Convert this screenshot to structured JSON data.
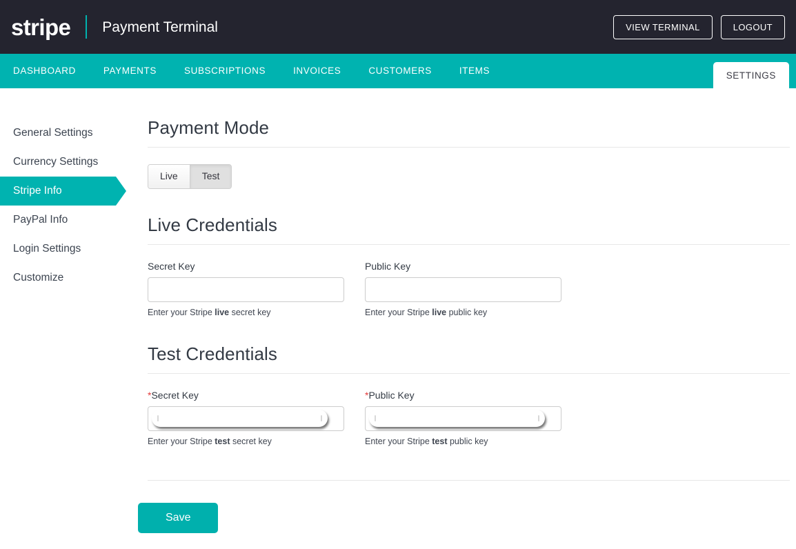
{
  "header": {
    "logo_text": "stripe",
    "title": "Payment Terminal",
    "view_terminal_label": "VIEW TERMINAL",
    "logout_label": "LOGOUT",
    "background_color": "#24242f",
    "accent_color": "#00b3b0"
  },
  "nav": {
    "items": [
      {
        "label": "DASHBOARD",
        "active": false
      },
      {
        "label": "PAYMENTS",
        "active": false
      },
      {
        "label": "SUBSCRIPTIONS",
        "active": false
      },
      {
        "label": "INVOICES",
        "active": false
      },
      {
        "label": "CUSTOMERS",
        "active": false
      },
      {
        "label": "ITEMS",
        "active": false
      }
    ],
    "settings_tab_label": "SETTINGS",
    "background_color": "#00b3b0"
  },
  "sidebar": {
    "items": [
      {
        "label": "General Settings",
        "active": false
      },
      {
        "label": "Currency Settings",
        "active": false
      },
      {
        "label": "Stripe Info",
        "active": true
      },
      {
        "label": "PayPal Info",
        "active": false
      },
      {
        "label": "Login Settings",
        "active": false
      },
      {
        "label": "Customize",
        "active": false
      }
    ],
    "active_color": "#00b3b0"
  },
  "main": {
    "payment_mode": {
      "title": "Payment Mode",
      "options": [
        {
          "label": "Live",
          "selected": false
        },
        {
          "label": "Test",
          "selected": true
        }
      ]
    },
    "live_credentials": {
      "title": "Live Credentials",
      "secret_key": {
        "label": "Secret Key",
        "required": false,
        "value": "",
        "placeholder": "",
        "help_prefix": "Enter your Stripe ",
        "help_bold": "live",
        "help_suffix": " secret key"
      },
      "public_key": {
        "label": "Public Key",
        "required": false,
        "value": "",
        "placeholder": "",
        "help_prefix": "Enter your Stripe ",
        "help_bold": "live",
        "help_suffix": " public key"
      }
    },
    "test_credentials": {
      "title": "Test Credentials",
      "secret_key": {
        "label": "Secret Key",
        "required": true,
        "required_marker": "*",
        "value": "",
        "masked": true,
        "placeholder": "",
        "help_prefix": "Enter your Stripe ",
        "help_bold": "test",
        "help_suffix": " secret key"
      },
      "public_key": {
        "label": "Public Key",
        "required": true,
        "required_marker": "*",
        "value": "",
        "masked": true,
        "placeholder": "",
        "help_prefix": "Enter your Stripe ",
        "help_bold": "test",
        "help_suffix": " public key"
      }
    },
    "save_label": "Save",
    "save_color": "#00b0ad"
  }
}
